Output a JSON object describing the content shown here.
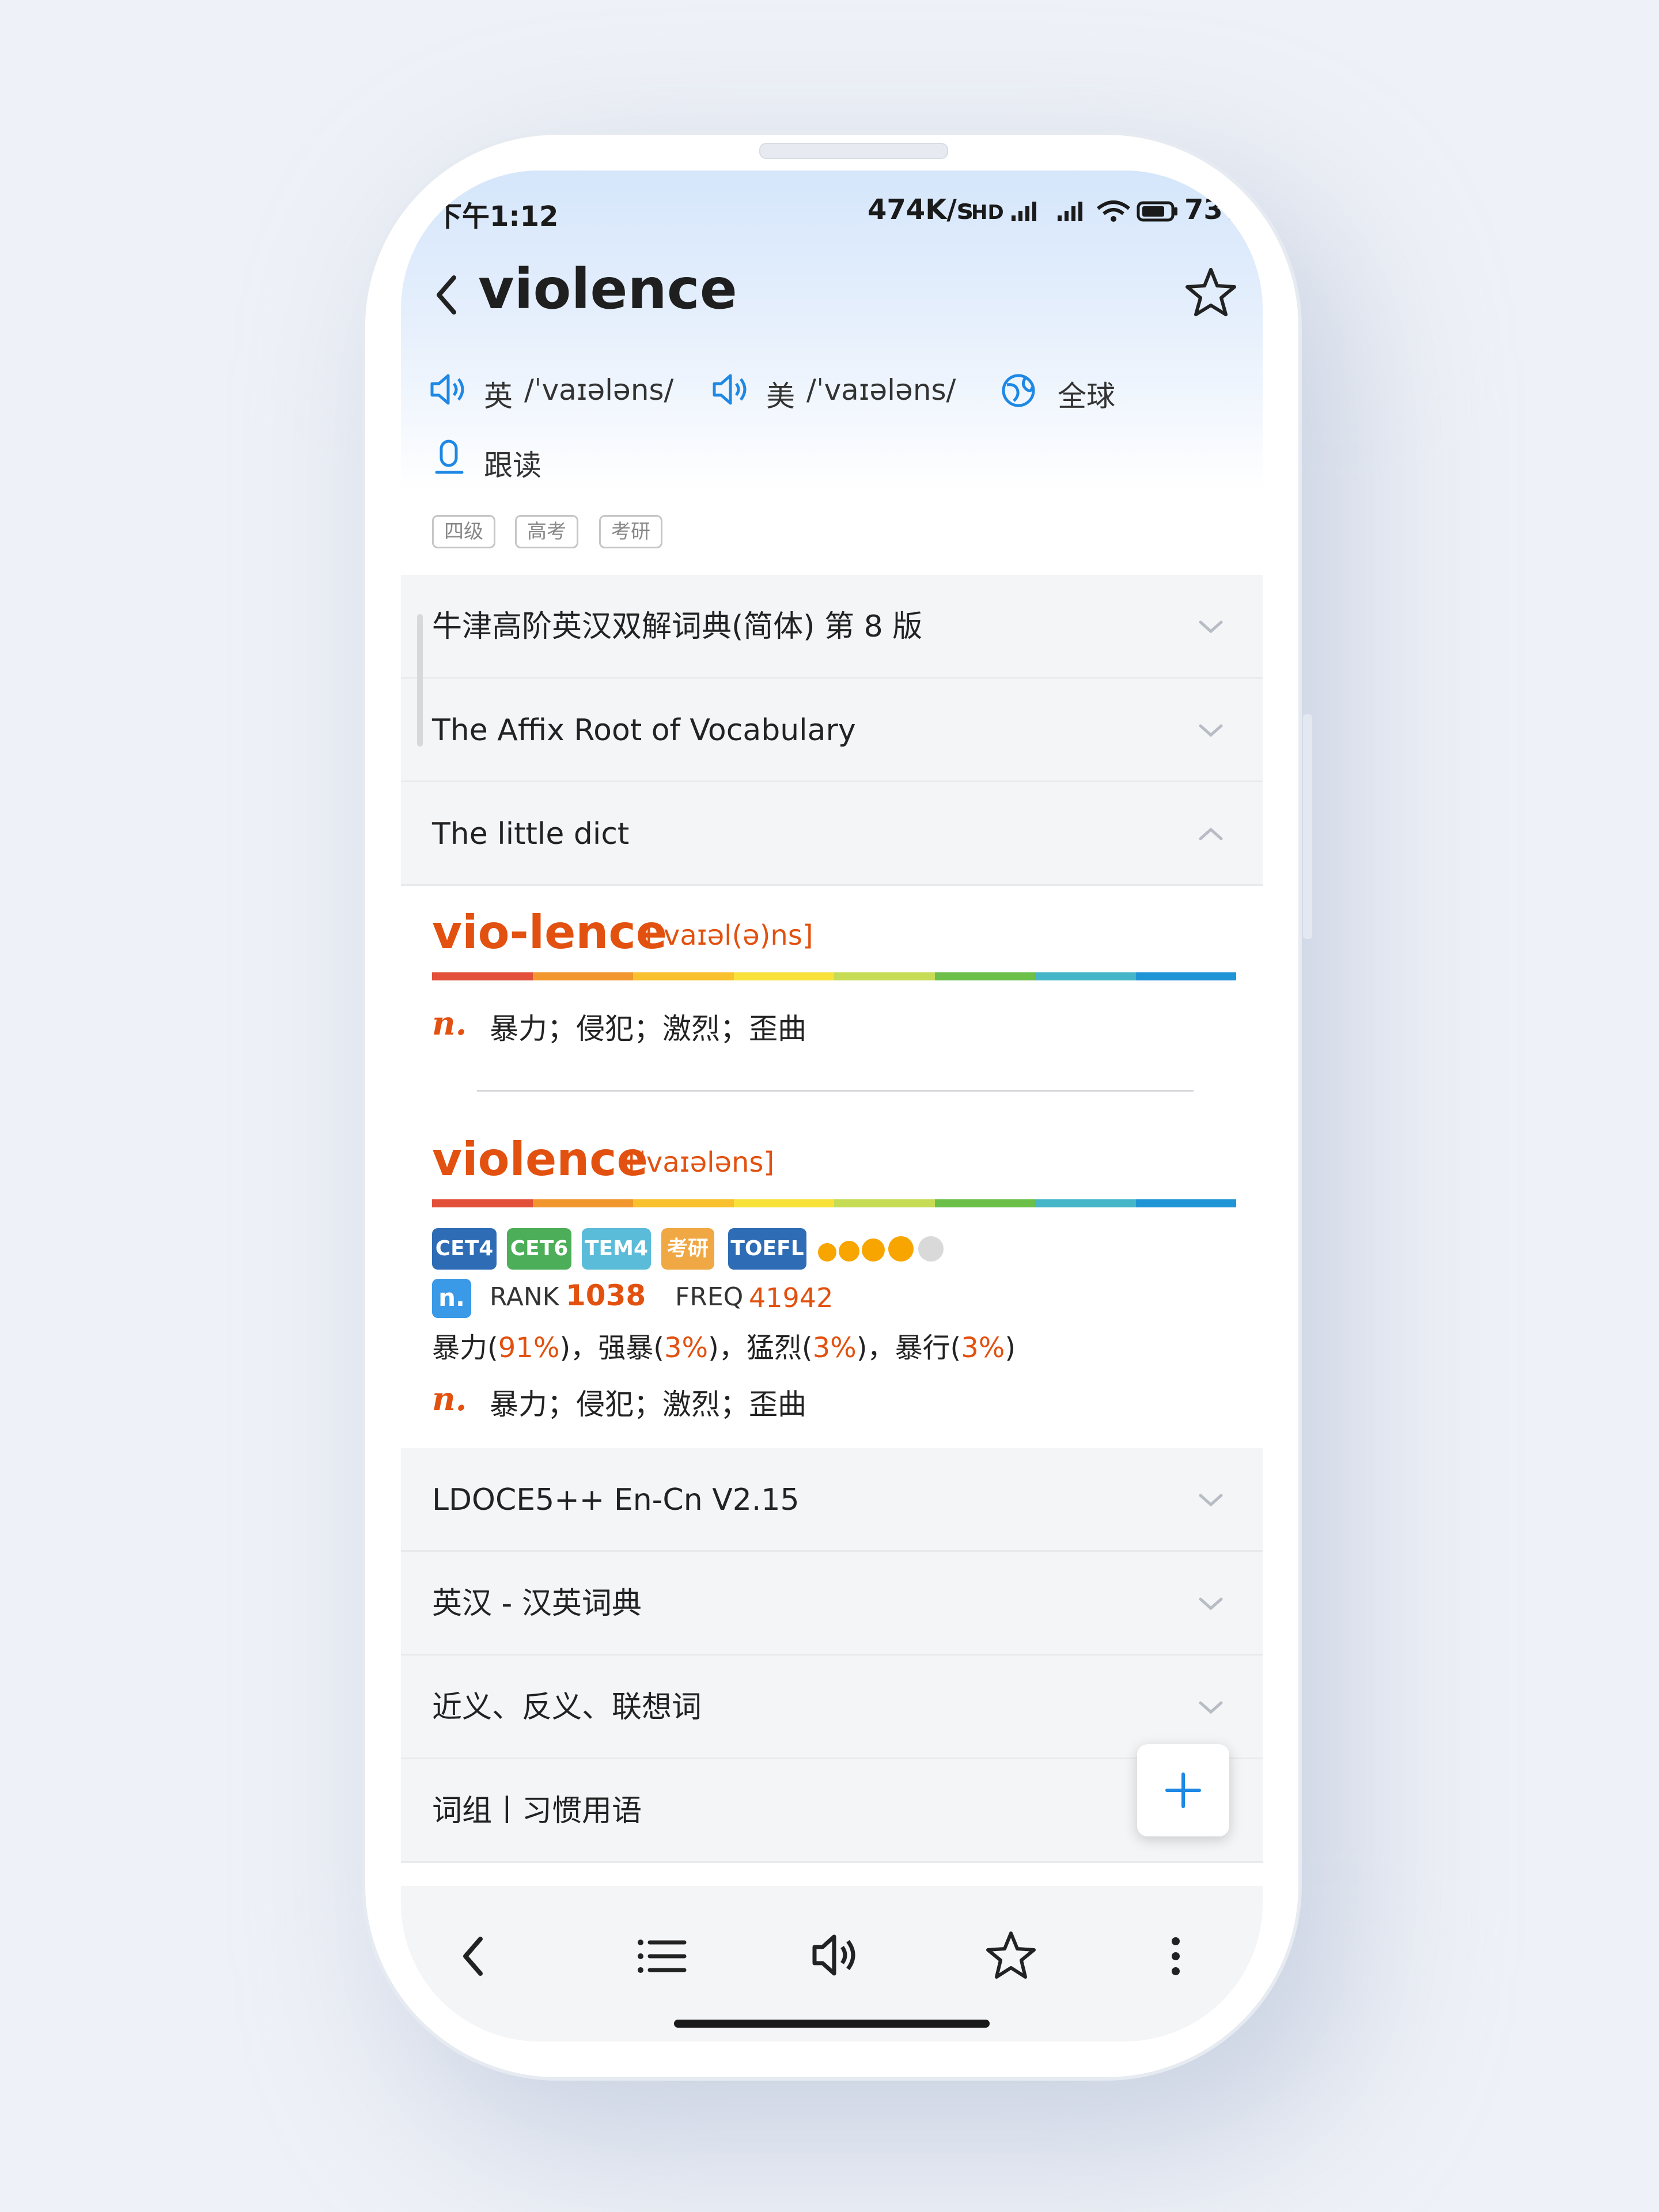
{
  "status_bar": {
    "time": "下午1:12",
    "network_speed": "474K/s",
    "battery": "73%"
  },
  "header": {
    "word": "violence",
    "back_icon": "chevron-left-icon",
    "favorite_icon": "star-outline-icon"
  },
  "pronunciation": {
    "uk_label": "英",
    "uk_ipa": "/ˈvaɪələns/",
    "us_label": "美",
    "us_ipa": "/ˈvaɪələns/",
    "global_label": "全球",
    "follow_read_label": "跟读"
  },
  "tags": [
    "四级",
    "高考",
    "考研"
  ],
  "dictionaries_top": [
    {
      "label": "牛津高阶英汉双解词典(简体) 第 8 版",
      "expanded": false
    },
    {
      "label": "The Affix Root of Vocabulary",
      "expanded": false
    },
    {
      "label": "The little dict",
      "expanded": true
    }
  ],
  "little_dict": {
    "entry1": {
      "headword": "vio-lence",
      "ipa": "['vaɪəl(ə)ns]",
      "pos": "n.",
      "definition": "暴力；侵犯；激烈；歪曲"
    },
    "entry2": {
      "headword": "violence",
      "ipa": "[ˈvaɪələns]",
      "badges": [
        {
          "label": "CET4",
          "color": "#2e6db5"
        },
        {
          "label": "CET6",
          "color": "#4cae58"
        },
        {
          "label": "TEM4",
          "color": "#5bbcd9"
        },
        {
          "label": "考研",
          "color": "#f0a844"
        },
        {
          "label": "TOEFL",
          "color": "#2e6db5"
        }
      ],
      "star_rating": {
        "filled": 4,
        "total": 5
      },
      "pos_badge": "n.",
      "rank_label": "RANK",
      "rank_value": "1038",
      "freq_label": "FREQ",
      "freq_value": "41942",
      "translations": [
        {
          "word": "暴力",
          "pct": "91%",
          "sep": "，"
        },
        {
          "word": "强暴",
          "pct": "3%",
          "sep": "，"
        },
        {
          "word": "猛烈",
          "pct": "3%",
          "sep": "，"
        },
        {
          "word": "暴行",
          "pct": "3%",
          "sep": ""
        }
      ],
      "pos": "n.",
      "definition": "暴力；侵犯；激烈；歪曲"
    }
  },
  "dictionaries_bottom": [
    {
      "label": "LDOCE5++ En-Cn V2.15"
    },
    {
      "label": "英汉 - 汉英词典"
    },
    {
      "label": "近义、反义、联想词"
    },
    {
      "label": "词组丨习惯用语"
    }
  ],
  "fab": {
    "icon": "plus-icon"
  },
  "bottom_nav": [
    "back-icon",
    "list-icon",
    "speaker-icon",
    "star-icon",
    "more-icon"
  ],
  "colors": {
    "accent_orange": "#e2510f",
    "link_blue": "#1e88e5",
    "rainbow": [
      "#e2503a",
      "#f2962e",
      "#f8c12d",
      "#f8e23a",
      "#c6dc55",
      "#6cc04a",
      "#45b6c8",
      "#1f95d6"
    ]
  }
}
